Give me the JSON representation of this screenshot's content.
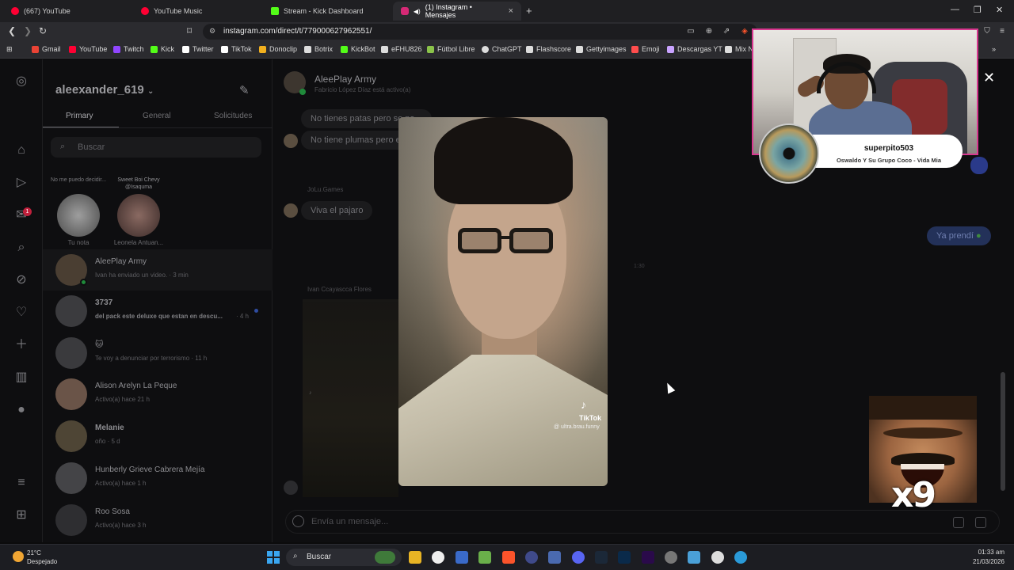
{
  "browser": {
    "tabs": [
      {
        "label": "(667) YouTube",
        "color": "#ff0033"
      },
      {
        "label": "YouTube Music",
        "color": "#ff0033"
      },
      {
        "label": "Stream - Kick Dashboard",
        "color": "#53fc18"
      },
      {
        "label": "(1) Instagram • Mensajes",
        "color": "#d62976"
      }
    ],
    "url": "instagram.com/direct/t/779000627962551/",
    "bookmarks": [
      {
        "label": "Gmail",
        "color": "#ea4335"
      },
      {
        "label": "YouTube",
        "color": "#ff0033"
      },
      {
        "label": "Twitch",
        "color": "#9146ff"
      },
      {
        "label": "Kick",
        "color": "#53fc18"
      },
      {
        "label": "Twitter",
        "color": "#ffffff"
      },
      {
        "label": "TikTok",
        "color": "#ffffff"
      },
      {
        "label": "Donoclip",
        "color": "#f2b01e"
      },
      {
        "label": "Botrix",
        "color": "#dddddd"
      },
      {
        "label": "KickBot",
        "color": "#53fc18"
      },
      {
        "label": "eFHU826",
        "color": "#dddddd"
      },
      {
        "label": "Fútbol Libre",
        "color": "#8bc34a"
      },
      {
        "label": "ChatGPT",
        "color": "#dddddd"
      },
      {
        "label": "Flashscore",
        "color": "#dddddd"
      },
      {
        "label": "Gettyimages",
        "color": "#dddddd"
      },
      {
        "label": "Emoji",
        "color": "#ff4d4d"
      },
      {
        "label": "Descargas YT",
        "color": "#c9a3ff"
      },
      {
        "label": "Mix N",
        "color": "#dddddd"
      }
    ]
  },
  "inbox": {
    "username": "aleexander_619",
    "tabs": [
      "Primary",
      "General",
      "Solicitudes"
    ],
    "search_placeholder": "Buscar",
    "notes": [
      {
        "bubble": "No me puedo decidir...",
        "name": "Tu nota"
      },
      {
        "bubble": "Sweet Boi Chevy @Isaquma",
        "name": "Leonela Antuan..."
      }
    ],
    "conversations": [
      {
        "name": "AleePlay Army",
        "sub": "Ivan ha enviado un video. · 3 min",
        "bold": false
      },
      {
        "name": "3737",
        "sub": "del pack este deluxe que estan en descu...",
        "time": "· 4 h",
        "bold": true
      },
      {
        "name": "",
        "sub": "Te voy a denunciar por terrorismo · 11 h",
        "bold": false
      },
      {
        "name": "Alison Arelyn La Peque",
        "sub": "Activo(a) hace 21 h",
        "bold": false
      },
      {
        "name": "Melanie",
        "sub": "oño · 5 d",
        "bold": false
      },
      {
        "name": "Hunberly Grieve Cabrera Mejía",
        "sub": "Activo(a) hace 1 h",
        "bold": false
      },
      {
        "name": "Roo Sosa",
        "sub": "Activo(a) hace 3 h",
        "bold": false
      }
    ],
    "badge_count": "1"
  },
  "chat": {
    "name": "AleePlay Army",
    "status": "Fabricio López Díaz está activo(a)",
    "messages": [
      {
        "text": "No tienes patas pero se pa..."
      },
      {
        "text": "No tiene plumas pero e..."
      },
      {
        "sender": "JoLu.Games",
        "text": "Viva el pajaro"
      }
    ],
    "sender_video": "Ivan Ccayascca Flores",
    "outgoing": "Ya prendí",
    "timestamp": "1:30",
    "composer_placeholder": "Envía un mensaje..."
  },
  "video": {
    "brand": "TikTok",
    "handle": "@ ultra.brau.funny"
  },
  "overlay": {
    "username": "superpito503",
    "song": "Oswaldo Y Su Grupo Coco - Vida Mia",
    "meme_count": "x9"
  },
  "taskbar": {
    "temp": "21°C",
    "weather": "Despejado",
    "search": "Buscar",
    "time": "01:33 am",
    "date": "21/03/2026"
  }
}
